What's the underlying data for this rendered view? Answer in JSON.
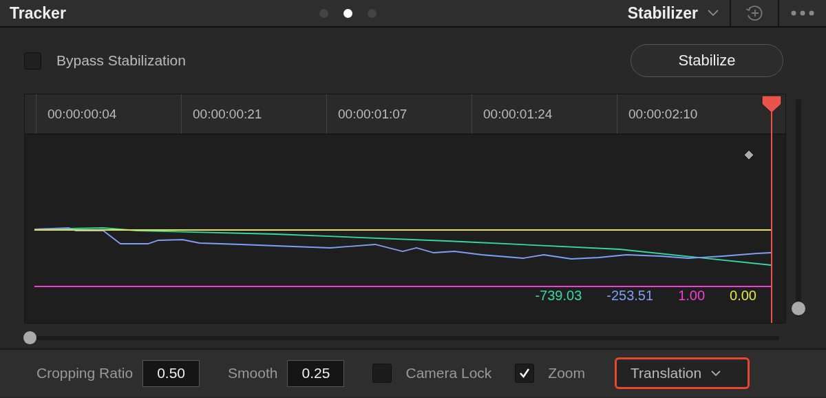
{
  "header": {
    "title": "Tracker",
    "pages": [
      {
        "selected": false
      },
      {
        "selected": true
      },
      {
        "selected": false
      }
    ],
    "mode": "Stabilizer"
  },
  "bypass": {
    "label": "Bypass Stabilization",
    "checked": false
  },
  "stabilize_button": "Stabilize",
  "timeline": {
    "timecodes": [
      "00:00:00:04",
      "00:00:00:21",
      "00:00:01:07",
      "00:00:01:24",
      "00:00:02:10"
    ],
    "readouts": [
      {
        "text": "-739.03",
        "color": "#35d9a2"
      },
      {
        "text": "-253.51",
        "color": "#7e9ff5"
      },
      {
        "text": "1.00",
        "color": "#f23fd6"
      },
      {
        "text": "0.00",
        "color": "#e6e64c"
      }
    ],
    "horizontal_slider": {
      "level": 0
    },
    "vertical_slider": {
      "level": 0
    }
  },
  "footer": {
    "cropping_ratio": {
      "label": "Cropping Ratio",
      "value": "0.50"
    },
    "smooth": {
      "label": "Smooth",
      "value": "0.25"
    },
    "camera_lock": {
      "label": "Camera Lock",
      "checked": false
    },
    "zoom": {
      "label": "Zoom",
      "checked": true
    },
    "mode_menu": "Translation"
  }
}
